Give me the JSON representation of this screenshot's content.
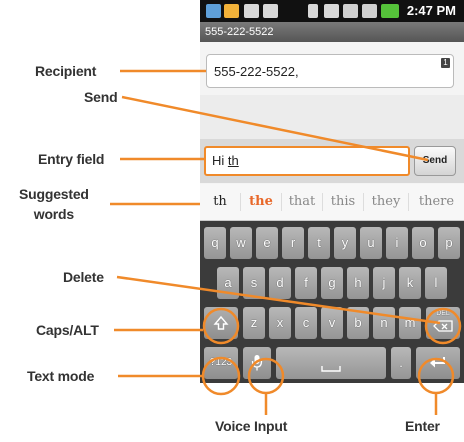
{
  "callouts": {
    "recipient": "Recipient",
    "send": "Send",
    "entry_field": "Entry field",
    "suggested_1": "Suggested",
    "suggested_2": "words",
    "delete": "Delete",
    "caps_alt": "Caps/ALT",
    "text_mode": "Text mode",
    "voice_input": "Voice Input",
    "enter": "Enter"
  },
  "accent_color": "#f08a2a",
  "status_bar": {
    "time": "2:47 PM"
  },
  "title_bar": {
    "title": "555-222-5522"
  },
  "recipient_field": {
    "value": "555-222-5522,",
    "badge": "1"
  },
  "compose": {
    "text_prefix": "Hi ",
    "text_composing": "th",
    "send_label": "Send"
  },
  "suggestions": [
    "th",
    "the",
    "that",
    "this",
    "they",
    "there"
  ],
  "keyboard": {
    "row1": [
      "q",
      "w",
      "e",
      "r",
      "t",
      "y",
      "u",
      "i",
      "o",
      "p"
    ],
    "row2": [
      "a",
      "s",
      "d",
      "f",
      "g",
      "h",
      "j",
      "k",
      "l"
    ],
    "row3": [
      "z",
      "x",
      "c",
      "v",
      "b",
      "n",
      "m"
    ],
    "shift_icon": "up-arrow-outline",
    "delete_label": "DEL",
    "text_mode_label": "?123",
    "mic_icon": "microphone",
    "space_icon": "space-bracket",
    "period": ".",
    "enter_icon": "return-arrow"
  }
}
